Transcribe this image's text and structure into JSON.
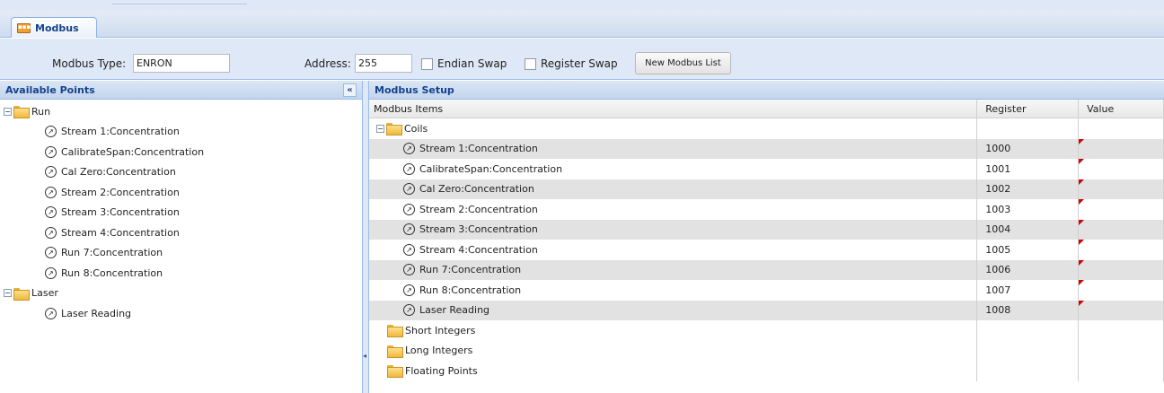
{
  "tab": {
    "label": "Modbus",
    "icon": "modbus-icon"
  },
  "toolbar": {
    "modbus_type_label": "Modbus Type:",
    "modbus_type_value": "ENRON",
    "address_label": "Address:",
    "address_value": "255",
    "endian_swap_label": "Endian Swap",
    "register_swap_label": "Register Swap",
    "new_list_button": "New Modbus List"
  },
  "available_points": {
    "title": "Available Points",
    "groups": [
      {
        "label": "Run",
        "items": [
          "Stream 1:Concentration",
          "CalibrateSpan:Concentration",
          "Cal Zero:Concentration",
          "Stream 2:Concentration",
          "Stream 3:Concentration",
          "Stream 4:Concentration",
          "Run 7:Concentration",
          "Run 8:Concentration"
        ]
      },
      {
        "label": "Laser",
        "items": [
          "Laser Reading"
        ]
      }
    ]
  },
  "modbus_setup": {
    "title": "Modbus Setup",
    "columns": [
      "Modbus Items",
      "Register",
      "Value"
    ],
    "coils_label": "Coils",
    "coils": [
      {
        "name": "Stream 1:Concentration",
        "register": "1000"
      },
      {
        "name": "CalibrateSpan:Concentration",
        "register": "1001"
      },
      {
        "name": "Cal Zero:Concentration",
        "register": "1002"
      },
      {
        "name": "Stream 2:Concentration",
        "register": "1003"
      },
      {
        "name": "Stream 3:Concentration",
        "register": "1004"
      },
      {
        "name": "Stream 4:Concentration",
        "register": "1005"
      },
      {
        "name": "Run 7:Concentration",
        "register": "1006"
      },
      {
        "name": "Run 8:Concentration",
        "register": "1007"
      },
      {
        "name": "Laser Reading",
        "register": "1008"
      }
    ],
    "other_folders": [
      "Short Integers",
      "Long Integers",
      "Floating Points"
    ]
  },
  "colors": {
    "header_text": "#15428b",
    "dirty_marker": "#d00000",
    "panel_border": "#99bbe8"
  }
}
